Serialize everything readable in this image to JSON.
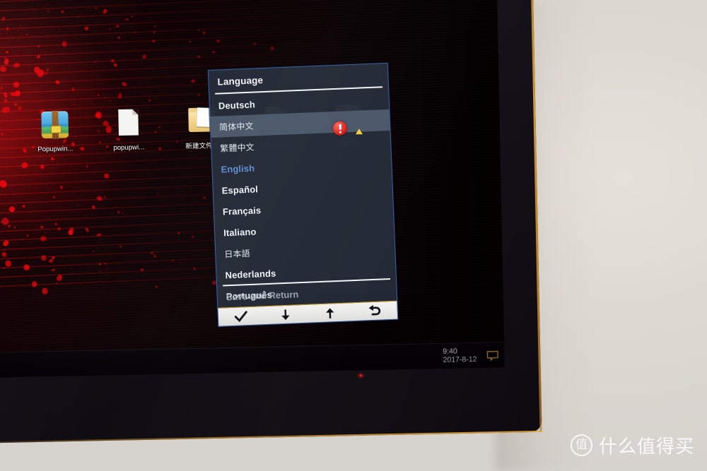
{
  "scene": {
    "description": "Photo of a monitor showing a Windows desktop with the monitor's on-screen-display (OSD) Language menu open",
    "wall_color": "#ded9d4",
    "bezel_color": "#121016",
    "bezel_edge_accent": "#e1a33a"
  },
  "desktop": {
    "wallpaper_accent": "#f3060c",
    "icons": [
      {
        "label": "Popupwin...",
        "icon": "archive-icon"
      },
      {
        "label": "popupwi...",
        "icon": "document-icon"
      },
      {
        "label": "新建文件夹",
        "icon": "folder-icon"
      },
      {
        "label": "popupwi...",
        "icon": "document-icon"
      },
      {
        "label": "ZZCG",
        "icon": "folder-warning-icon"
      }
    ]
  },
  "taskbar": {
    "clock_time": "9:40",
    "clock_date": "2017-8-12",
    "notification_icon": "notification-balloon-icon"
  },
  "osd": {
    "title": "Language",
    "selected_color": "#4b5869",
    "current_color": "#5d90d6",
    "items": [
      {
        "label": "Deutsch",
        "state": "normal",
        "script": "latin"
      },
      {
        "label": "简体中文",
        "state": "selected",
        "script": "cjk"
      },
      {
        "label": "繁體中文",
        "state": "normal",
        "script": "cjk"
      },
      {
        "label": "English",
        "state": "current",
        "script": "latin"
      },
      {
        "label": "Español",
        "state": "normal",
        "script": "latin"
      },
      {
        "label": "Français",
        "state": "normal",
        "script": "latin"
      },
      {
        "label": "Italiano",
        "state": "normal",
        "script": "latin"
      },
      {
        "label": "日本語",
        "state": "normal",
        "script": "cjk"
      },
      {
        "label": "Nederlands",
        "state": "normal",
        "script": "latin"
      },
      {
        "label": "Português",
        "state": "normal",
        "script": "latin"
      }
    ],
    "footer_label": "Save and Return",
    "buttons": [
      {
        "icon": "check-icon",
        "name": "confirm-button"
      },
      {
        "icon": "arrow-down-icon",
        "name": "down-button"
      },
      {
        "icon": "arrow-up-icon",
        "name": "up-button"
      },
      {
        "icon": "back-arrow-icon",
        "name": "back-button"
      }
    ]
  },
  "watermark": {
    "logo_char": "值",
    "text": "什么值得买"
  }
}
